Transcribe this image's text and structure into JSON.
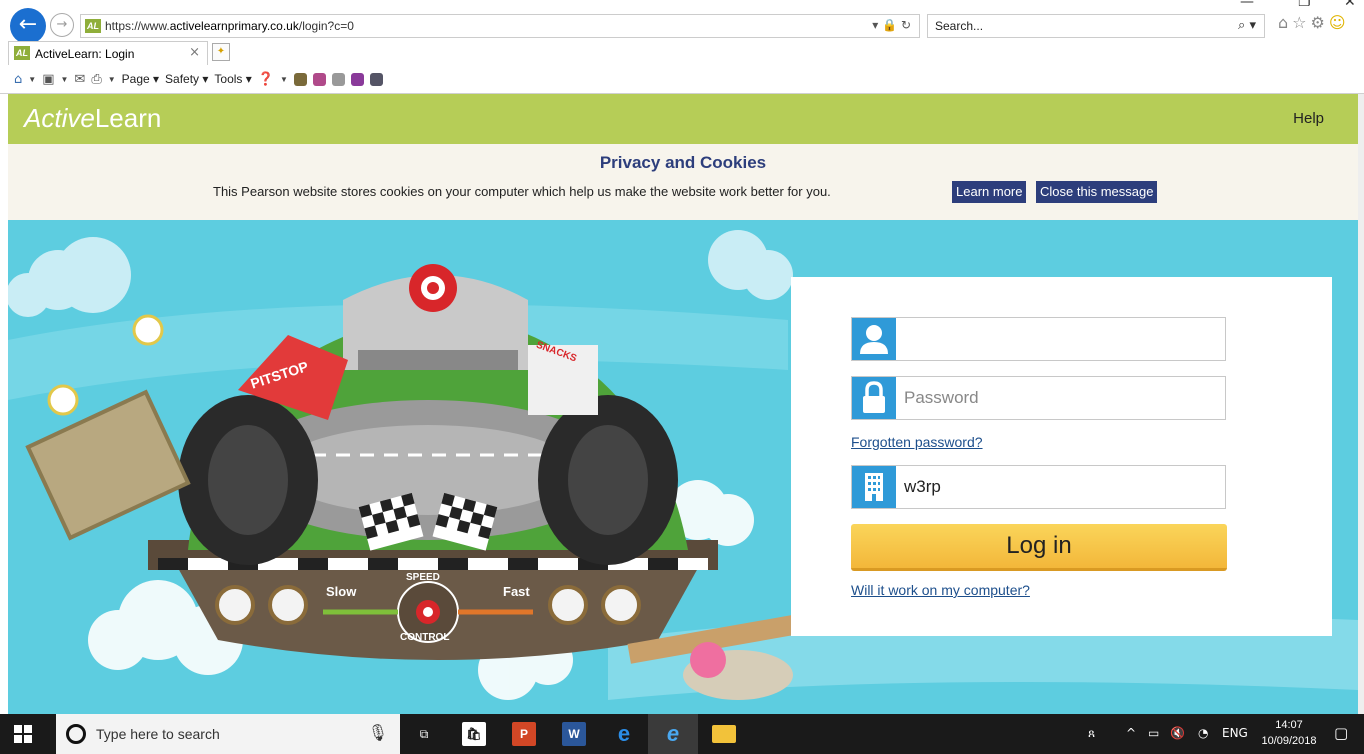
{
  "browser": {
    "url_prefix": "https://www.",
    "url_host": "activelearnprimary.co.uk",
    "url_path": "/login?c=0",
    "favicon_text": "AL",
    "search_placeholder": "Search...",
    "tab_title": "ActiveLearn: Login",
    "commands": {
      "page": "Page",
      "safety": "Safety",
      "tools": "Tools"
    }
  },
  "site": {
    "logo_active": "Active",
    "logo_learn": "Learn",
    "help": "Help",
    "brand_color": "#b6cd57"
  },
  "cookie_banner": {
    "title": "Privacy and Cookies",
    "text": "This Pearson website stores cookies on your computer which help us make the website work better for you.",
    "learn_more": "Learn more",
    "close": "Close this message"
  },
  "hero": {
    "slow": "Slow",
    "fast": "Fast",
    "speed": "SPEED",
    "control": "CONTROL",
    "pitstop": "PITSTOP",
    "snacks": "SNACKS"
  },
  "login": {
    "username_value": "",
    "password_placeholder": "Password",
    "forgot": "Forgotten password?",
    "school_code": "w3rp",
    "button": "Log in",
    "compat_link": "Will it work on my computer?",
    "icon_color": "#2f9ad8"
  },
  "taskbar": {
    "search_text": "Type here to search",
    "lang": "ENG",
    "time": "14:07",
    "date": "10/09/2018"
  }
}
